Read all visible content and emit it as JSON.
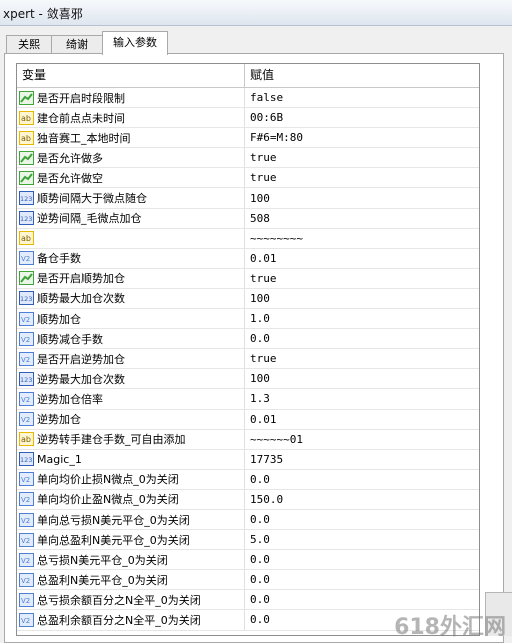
{
  "window": {
    "title": "xpert - 敛喜邪"
  },
  "tabs": [
    {
      "label": "关熙",
      "active": false
    },
    {
      "label": "绮谢",
      "active": false
    },
    {
      "label": "输入参数",
      "active": true
    }
  ],
  "grid": {
    "headers": {
      "name": "变量",
      "value": "赋值"
    },
    "rows": [
      {
        "icon": "bool",
        "name": "是否开启时段限制",
        "value": "false"
      },
      {
        "icon": "string",
        "name": "建仓前点点未时间",
        "value": "00:6B"
      },
      {
        "icon": "string",
        "name": "独音赛工_本地时间",
        "value": "F#6=M:80"
      },
      {
        "icon": "bool",
        "name": "是否允许做多",
        "value": "true"
      },
      {
        "icon": "bool",
        "name": "是否允许做空",
        "value": "true"
      },
      {
        "icon": "int",
        "name": "顺势间隔大于微点随仓",
        "value": "100"
      },
      {
        "icon": "int",
        "name": "逆势间隔_毛微点加仓",
        "value": "508"
      },
      {
        "icon": "string",
        "name": "",
        "value": "~~~~~~~~"
      },
      {
        "icon": "double",
        "name": "备仓手数",
        "value": "0.01"
      },
      {
        "icon": "bool",
        "name": "是否开启顺势加仓",
        "value": "true"
      },
      {
        "icon": "int",
        "name": "顺势最大加仓次数",
        "value": "100"
      },
      {
        "icon": "double",
        "name": "顺势加仓",
        "value": "1.0"
      },
      {
        "icon": "double",
        "name": "顺势减仓手数",
        "value": "0.0"
      },
      {
        "icon": "double",
        "name": "是否开启逆势加仓",
        "value": "true"
      },
      {
        "icon": "int",
        "name": "逆势最大加仓次数",
        "value": "100"
      },
      {
        "icon": "double",
        "name": "逆势加仓倍率",
        "value": "1.3"
      },
      {
        "icon": "double",
        "name": "逆势加仓",
        "value": "0.01"
      },
      {
        "icon": "string",
        "name": "逆势转手建仓手数_可自由添加",
        "value": "~~~~~~01"
      },
      {
        "icon": "int",
        "name": "Magic_1",
        "value": "17735"
      },
      {
        "icon": "double",
        "name": "单向均价止损N微点_0为关闭",
        "value": "0.0"
      },
      {
        "icon": "double",
        "name": "单向均价止盈N微点_0为关闭",
        "value": "150.0"
      },
      {
        "icon": "double",
        "name": "单向总亏损N美元平仓_0为关闭",
        "value": "0.0"
      },
      {
        "icon": "double",
        "name": "单向总盈利N美元平仓_0为关闭",
        "value": "5.0"
      },
      {
        "icon": "double",
        "name": "总亏损N美元平仓_0为关闭",
        "value": "0.0"
      },
      {
        "icon": "double",
        "name": "总盈利N美元平仓_0为关闭",
        "value": "0.0"
      },
      {
        "icon": "double",
        "name": "总亏损余额百分之N全平_0为关闭",
        "value": "0.0"
      },
      {
        "icon": "double",
        "name": "总盈利余额百分之N全平_0为关闭",
        "value": "0.0"
      }
    ]
  },
  "watermark": "618外汇网",
  "colors": {
    "bool_icon": "#3fa43b",
    "string_icon": "#e6b800",
    "int_icon": "#2f5fb8",
    "double_icon": "#4d7fd6"
  }
}
